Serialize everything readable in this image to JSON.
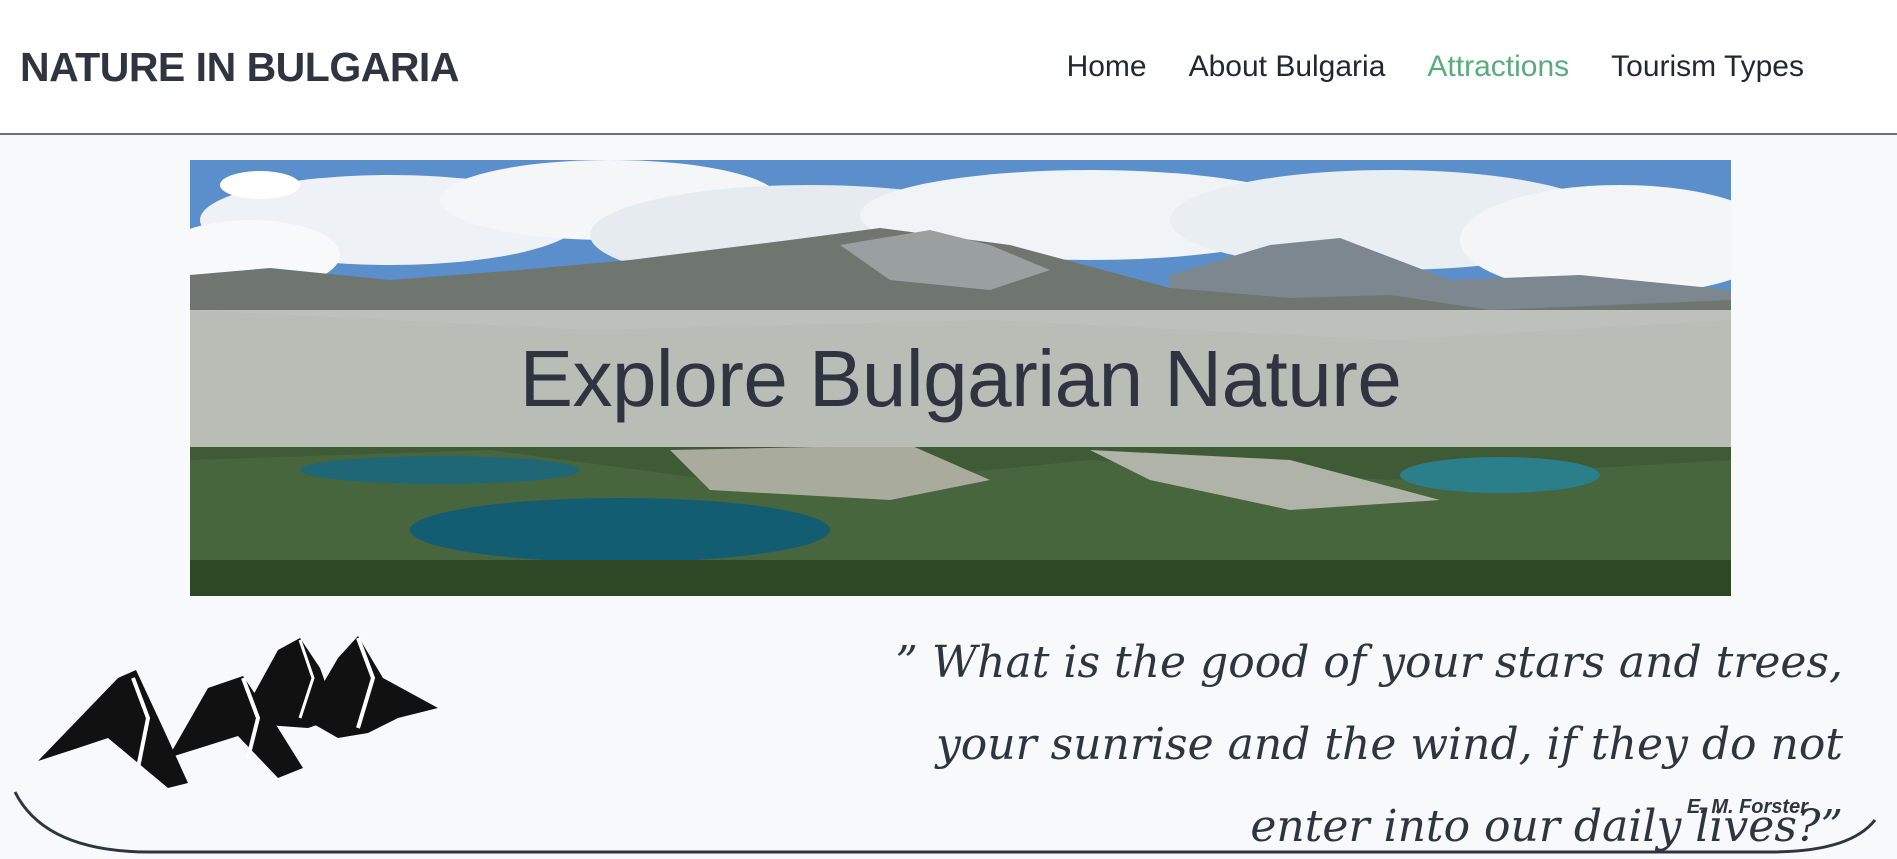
{
  "header": {
    "brand": "NATURE IN BULGARIA",
    "nav": [
      {
        "label": "Home",
        "active": false
      },
      {
        "label": "About Bulgaria",
        "active": false
      },
      {
        "label": "Attractions",
        "active": true
      },
      {
        "label": "Tourism Types",
        "active": false
      }
    ]
  },
  "hero": {
    "title": "Explore Bulgarian Nature",
    "image": "mountain-lakes-panorama"
  },
  "quote": {
    "text": "” What is the good of your stars and trees, your sunrise and the wind, if they do not enter into our daily lives?”",
    "author": "E. M. Forster"
  },
  "icons": {
    "logo": "mountains-icon"
  },
  "colors": {
    "accent": "#5aac7c",
    "text": "#2f3540",
    "background": "#f8f9fa"
  }
}
